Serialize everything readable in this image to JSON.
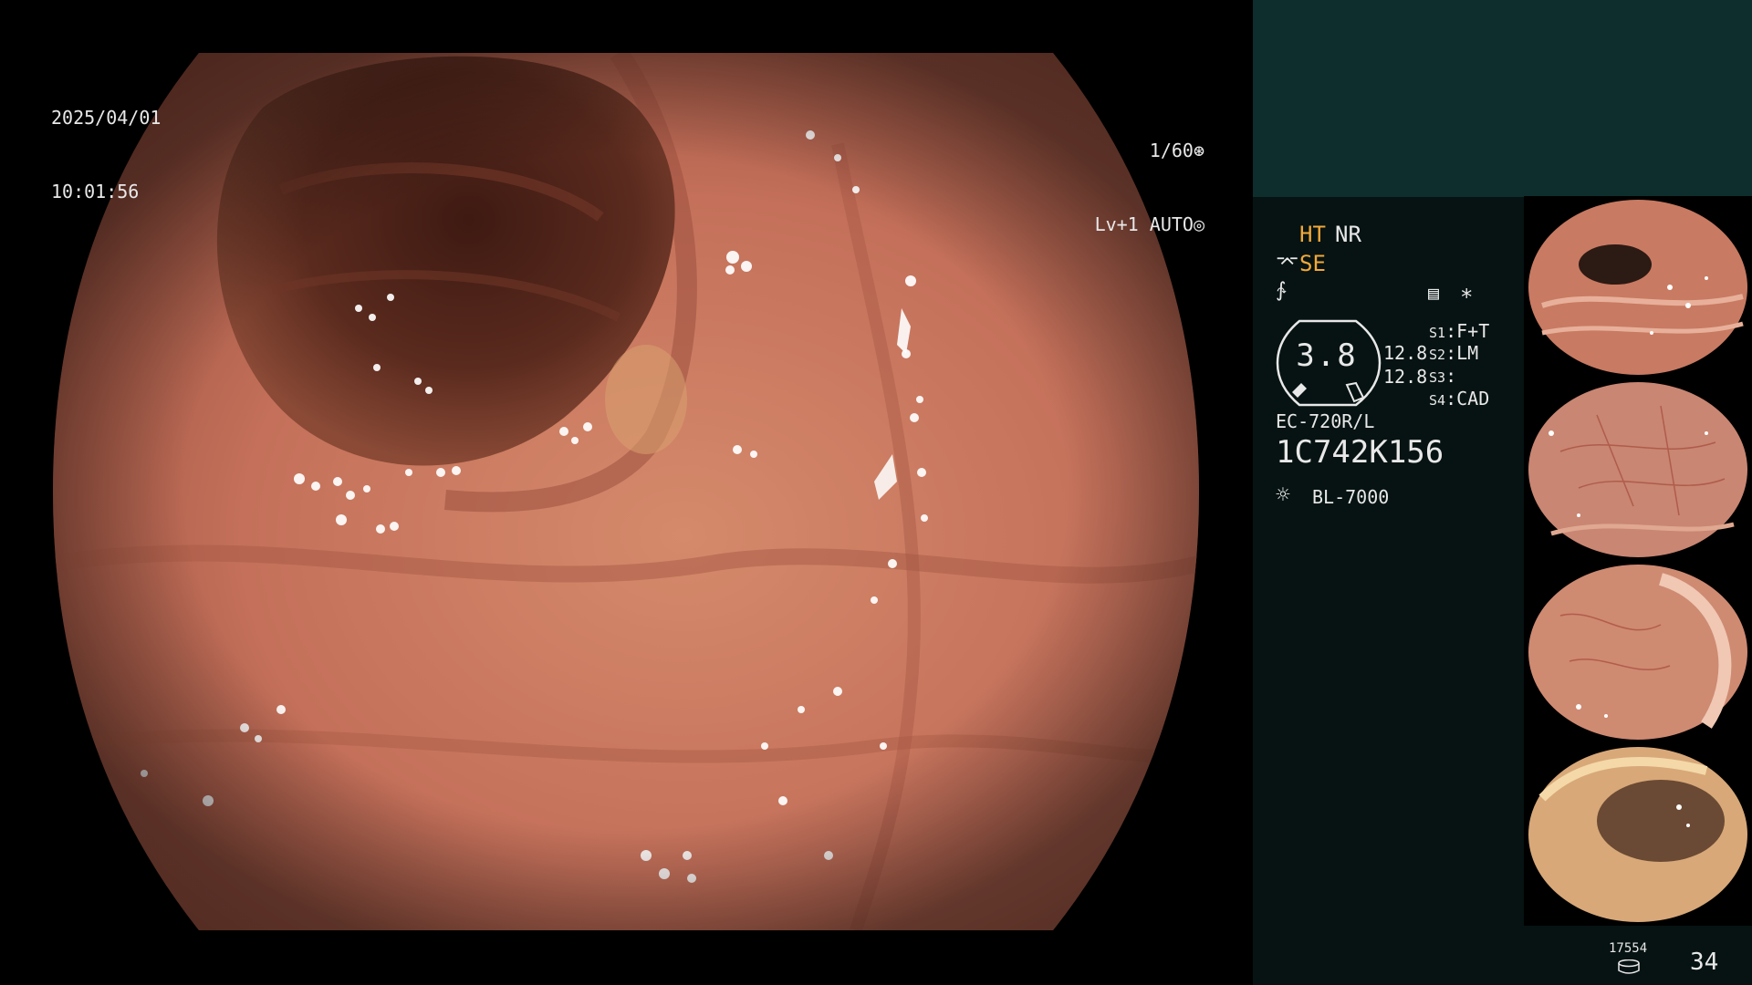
{
  "capture": {
    "date": "2025/04/01",
    "time": "10:01:56"
  },
  "camera": {
    "shutter": "1/60",
    "level": "Lv+1",
    "mode": "AUTO"
  },
  "status": {
    "ht": "HT",
    "nr": "NR",
    "se": "SE",
    "gauge_value": "3.8",
    "value_1": "12.8",
    "value_2": "12.8",
    "s1_label": "S1",
    "s1_value": "F+T",
    "s2_label": "S2",
    "s2_value": "LM",
    "s3_label": "S3",
    "s3_value": "",
    "s4_label": "S4",
    "s4_value": "CAD",
    "scope_model": "EC-720R/L",
    "scope_serial": "1C742K156",
    "light_source": "BL-7000"
  },
  "thumbnails": {
    "count": 4,
    "serial_label": "1C742K156"
  },
  "footer": {
    "storage_count": "17554",
    "image_count": "34"
  },
  "colors": {
    "overlay_text": "#e8e8e8",
    "accent": "#f2a83a",
    "panel_bg": "#061312",
    "panel_top": "#0d2e2c",
    "mucosa": "#c5735d",
    "lumen": "#5a2a1e"
  },
  "icons": [
    "shutter-icon",
    "auto-icon",
    "se-curve-icon",
    "f-curve-icon",
    "menu-icon",
    "star-icon",
    "lamp-icon",
    "storage-icon"
  ]
}
